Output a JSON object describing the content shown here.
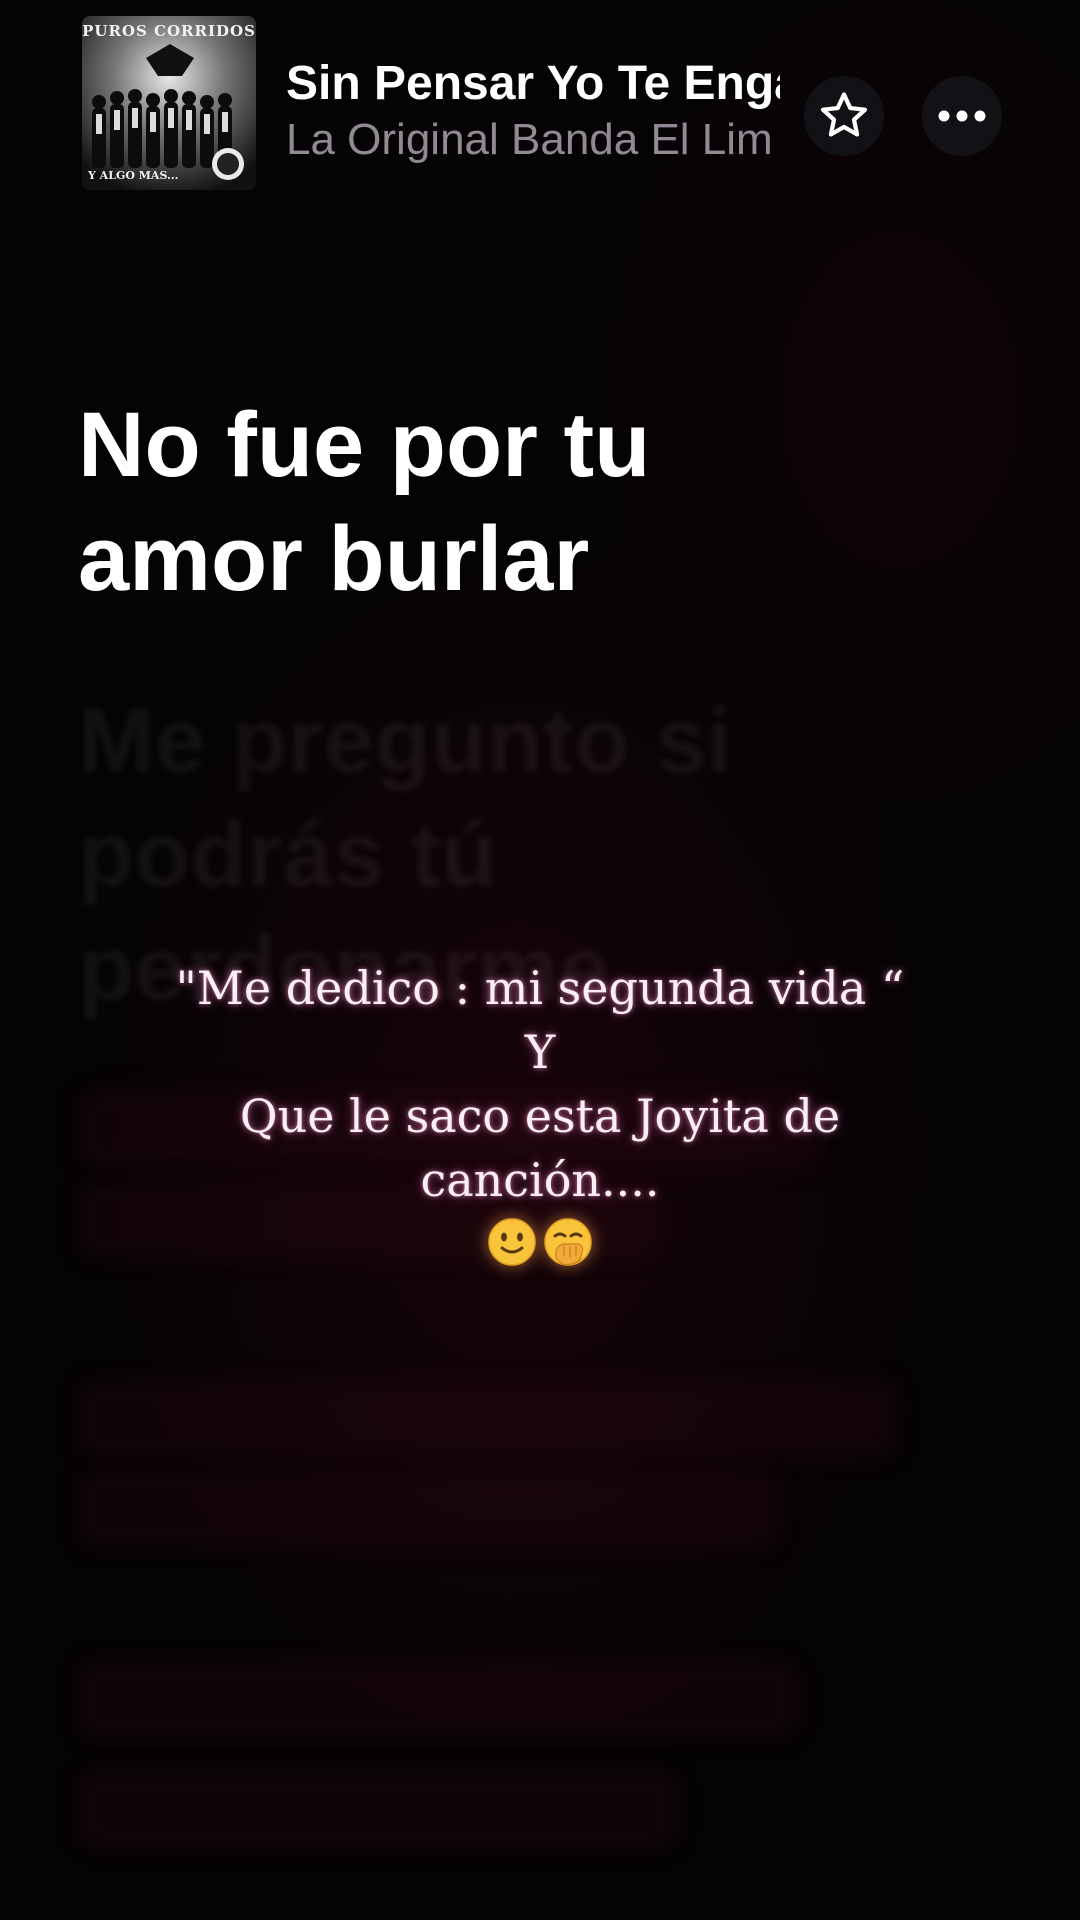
{
  "header": {
    "album_art": {
      "top_text": "PUROS CORRIDOS",
      "bottom_text": "Y ALGO MAS..."
    },
    "track_title": "Sin Pensar Yo Te Enga",
    "artist": "La Original Banda El Lim",
    "favorite_icon": "star-outline-icon",
    "more_icon": "ellipsis-icon"
  },
  "lyrics": {
    "previous_lines": [
      "",
      ""
    ],
    "current_line": [
      "No fue por tu",
      "amor burlar"
    ],
    "upcoming_lines": [
      "Me pregunto si",
      "podrás tú",
      "perdonarme"
    ]
  },
  "overlay": {
    "lines": [
      "\"Me dedico : mi segunda vida “",
      "Y",
      "Que le saco esta Joyita de",
      "canción...."
    ],
    "emojis": [
      "slightly-smiling-face",
      "face-with-hand-over-mouth"
    ]
  },
  "colors": {
    "background": "#050304",
    "lyric_active": "#ffffff",
    "artist_text": "#8f8a94",
    "overlay_glow": "#ff78c8"
  }
}
